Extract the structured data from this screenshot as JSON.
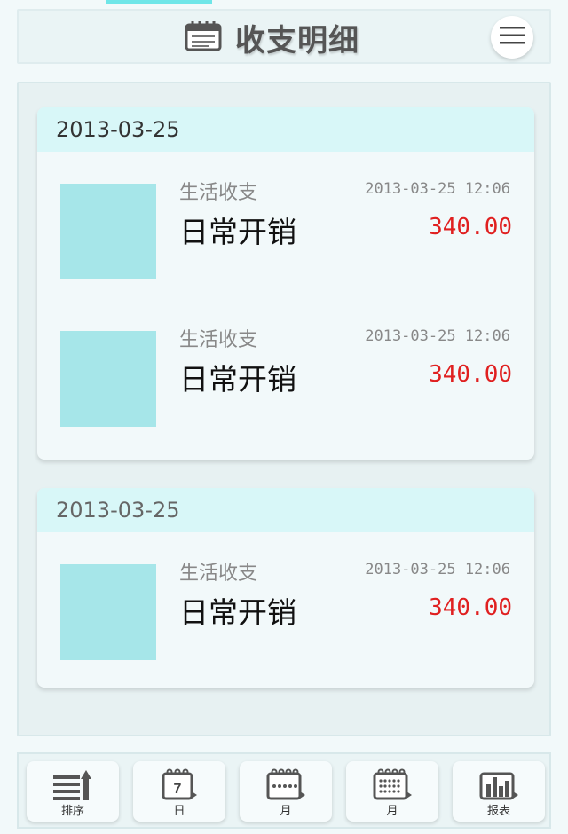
{
  "header": {
    "title": "收支明细",
    "title_icon": "notepad-icon",
    "menu_icon": "hamburger-menu-icon"
  },
  "groups": [
    {
      "date": "2013-03-25",
      "entries": [
        {
          "category": "生活收支",
          "time": "2013-03-25 12:06",
          "name": "日常开销",
          "amount": "340.00"
        },
        {
          "category": "生活收支",
          "time": "2013-03-25 12:06",
          "name": "日常开销",
          "amount": "340.00"
        }
      ]
    },
    {
      "date": "2013-03-25",
      "entries": [
        {
          "category": "生活收支",
          "time": "2013-03-25 12:06",
          "name": "日常开销",
          "amount": "340.00"
        }
      ]
    }
  ],
  "toolbar": {
    "sort_label": "排序",
    "day_label": "日",
    "day_number": "7",
    "week_label": "月",
    "month_label": "月",
    "report_label": "报表"
  },
  "colors": {
    "accent": "#6fe6e8",
    "date_header": "#d8f7f8",
    "thumb": "#a6e6e9",
    "amount": "#e02020"
  }
}
